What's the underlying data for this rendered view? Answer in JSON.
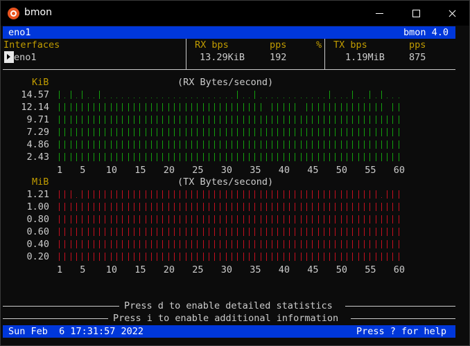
{
  "window": {
    "title": "bmon"
  },
  "header": {
    "interface": "eno1",
    "version": "bmon 4.0"
  },
  "table": {
    "col_interfaces": "Interfaces",
    "col_rx_bps": "RX bps",
    "col_rx_pps": "pps",
    "col_pct": "%",
    "col_tx_bps": "TX bps",
    "col_tx_pps": "pps",
    "row": {
      "name": "eno1",
      "rx_bps": "13.29KiB",
      "rx_pps": "192",
      "tx_bps": "1.19MiB",
      "tx_pps": "875"
    }
  },
  "rx_graph": {
    "unit": "KiB",
    "title": "(RX Bytes/second)",
    "y_labels": [
      "14.57",
      "12.14",
      "9.71",
      "7.29",
      "4.86",
      "2.43"
    ],
    "x_labels": [
      "1",
      "5",
      "10",
      "15",
      "20",
      "25",
      "30",
      "35",
      "40",
      "45",
      "50",
      "55",
      "60"
    ]
  },
  "tx_graph": {
    "unit": "MiB",
    "title": "(TX Bytes/second)",
    "y_labels": [
      "1.21",
      "1.00",
      "0.80",
      "0.60",
      "0.40",
      "0.20"
    ],
    "x_labels": [
      "1",
      "5",
      "10",
      "15",
      "20",
      "25",
      "30",
      "35",
      "40",
      "45",
      "50",
      "55",
      "60"
    ]
  },
  "chart_data": [
    {
      "type": "bar",
      "title": "(RX Bytes/second)",
      "ylabel": "KiB",
      "y_tick_labels": [
        "2.43",
        "4.86",
        "7.29",
        "9.71",
        "12.14",
        "14.57"
      ],
      "x_tick_labels": [
        "1",
        "5",
        "10",
        "15",
        "20",
        "25",
        "30",
        "35",
        "40",
        "45",
        "50",
        "55",
        "60"
      ],
      "categories": [
        1,
        2,
        3,
        4,
        5,
        6,
        7,
        8,
        9,
        10,
        11,
        12,
        13,
        14,
        15,
        16,
        17,
        18,
        19,
        20,
        21,
        22,
        23,
        24,
        25,
        26,
        27,
        28,
        28,
        30,
        31,
        32,
        33,
        34,
        35,
        36,
        37,
        38,
        39,
        40,
        41,
        42,
        43,
        44,
        45,
        46,
        47,
        48,
        49,
        50,
        51,
        52,
        53,
        54,
        55,
        56,
        57,
        58,
        59,
        60
      ],
      "levels": [
        6,
        5,
        6,
        5,
        6,
        5,
        5,
        6,
        5,
        5,
        5,
        5,
        5,
        5,
        5,
        5,
        5,
        5,
        5,
        5,
        5,
        5,
        5,
        5,
        5,
        5,
        5,
        5,
        5,
        5,
        5,
        6,
        5,
        5,
        6,
        5,
        4,
        5,
        5,
        5,
        5,
        5,
        4,
        5,
        5,
        5,
        5,
        6,
        5,
        5,
        5,
        6,
        5,
        5,
        6,
        5,
        6,
        4,
        5,
        5
      ],
      "max_level": 6
    },
    {
      "type": "bar",
      "title": "(TX Bytes/second)",
      "ylabel": "MiB",
      "y_tick_labels": [
        "0.20",
        "0.40",
        "0.60",
        "0.80",
        "1.00",
        "1.21"
      ],
      "x_tick_labels": [
        "1",
        "5",
        "10",
        "15",
        "20",
        "25",
        "30",
        "35",
        "40",
        "45",
        "50",
        "55",
        "60"
      ],
      "categories": [
        1,
        2,
        3,
        4,
        5,
        6,
        7,
        8,
        9,
        10,
        11,
        12,
        13,
        14,
        15,
        16,
        17,
        18,
        19,
        20,
        21,
        22,
        23,
        24,
        25,
        26,
        27,
        28,
        28,
        30,
        31,
        32,
        33,
        34,
        35,
        36,
        37,
        38,
        39,
        40,
        41,
        42,
        43,
        44,
        45,
        46,
        47,
        48,
        49,
        50,
        51,
        52,
        53,
        54,
        55,
        56,
        57,
        58,
        59,
        60
      ],
      "levels": [
        6,
        6,
        6,
        5,
        6,
        6,
        6,
        6,
        6,
        6,
        6,
        6,
        6,
        6,
        6,
        6,
        6,
        6,
        6,
        6,
        6,
        6,
        6,
        6,
        6,
        6,
        6,
        6,
        6,
        6,
        6,
        6,
        6,
        6,
        6,
        6,
        6,
        6,
        6,
        6,
        6,
        6,
        6,
        6,
        6,
        6,
        6,
        6,
        6,
        6,
        6,
        6,
        6,
        6,
        6,
        6,
        5,
        6,
        6,
        6
      ],
      "max_level": 6
    }
  ],
  "hints": {
    "detailed": "Press d to enable detailed statistics",
    "additional": "Press i to enable additional information"
  },
  "status": {
    "datetime": "Sun Feb  6 17:31:57 2022",
    "help": "Press ? for help"
  },
  "colors": {
    "header_bg": "#0037da",
    "rx": "#13a10e",
    "tx": "#c50f1f",
    "label": "#c19c00"
  }
}
